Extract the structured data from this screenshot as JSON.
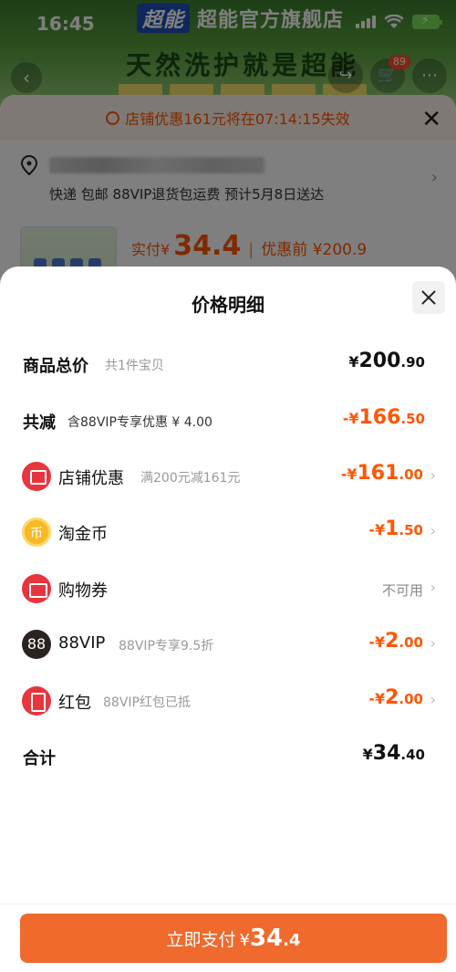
{
  "status_bar": {
    "time": "16:45"
  },
  "background": {
    "brand_logo": "超能",
    "store_name": "超能官方旗舰店",
    "slogan": "天然洗护就是超能",
    "cart_count": "89",
    "countdown": "店铺优惠161元将在07:14:15失效",
    "delivery": "快递 包邮 88VIP退货包运费 预计5月8日送达",
    "pay_label": "实付",
    "currency": "¥",
    "pay_amount": "34.4",
    "before_discount": "优惠前 ¥200.9"
  },
  "sheet": {
    "title": "价格明细",
    "rows": [
      {
        "name": "商品总价",
        "sub": "共1件宝贝",
        "cur": "¥",
        "int": "200",
        "dec": ".90"
      },
      {
        "name": "共减",
        "sub": "含88VIP专享优惠 ¥ 4.00",
        "cur": "-¥",
        "int": "166",
        "dec": ".50"
      },
      {
        "name": "店铺优惠",
        "sub": "满200元减161元",
        "cur": "-¥",
        "int": "161",
        "dec": ".00",
        "icon": "shop-icon"
      },
      {
        "name": "淘金币",
        "sub": "",
        "cur": "-¥",
        "int": "1",
        "dec": ".50",
        "icon": "coin-icon"
      },
      {
        "name": "购物券",
        "sub": "",
        "value": "不可用",
        "icon": "voucher-icon"
      },
      {
        "name": "88VIP",
        "sub": "88VIP专享9.5折",
        "cur": "-¥",
        "int": "2",
        "dec": ".00",
        "icon": "88vip-icon",
        "icon_text": "88"
      },
      {
        "name": "红包",
        "sub": "88VIP红包已抵",
        "cur": "-¥",
        "int": "2",
        "dec": ".00",
        "icon": "red-packet-icon"
      },
      {
        "name": "合计",
        "sub": "",
        "cur": "¥",
        "int": "34",
        "dec": ".40"
      }
    ]
  },
  "footer": {
    "pay_label": "立即支付",
    "cur": "¥",
    "int": "34",
    "dec": ".4"
  },
  "colors": {
    "accent": "#ff5500",
    "button": "#ef6a2c",
    "icon_red": "#e8343d"
  }
}
